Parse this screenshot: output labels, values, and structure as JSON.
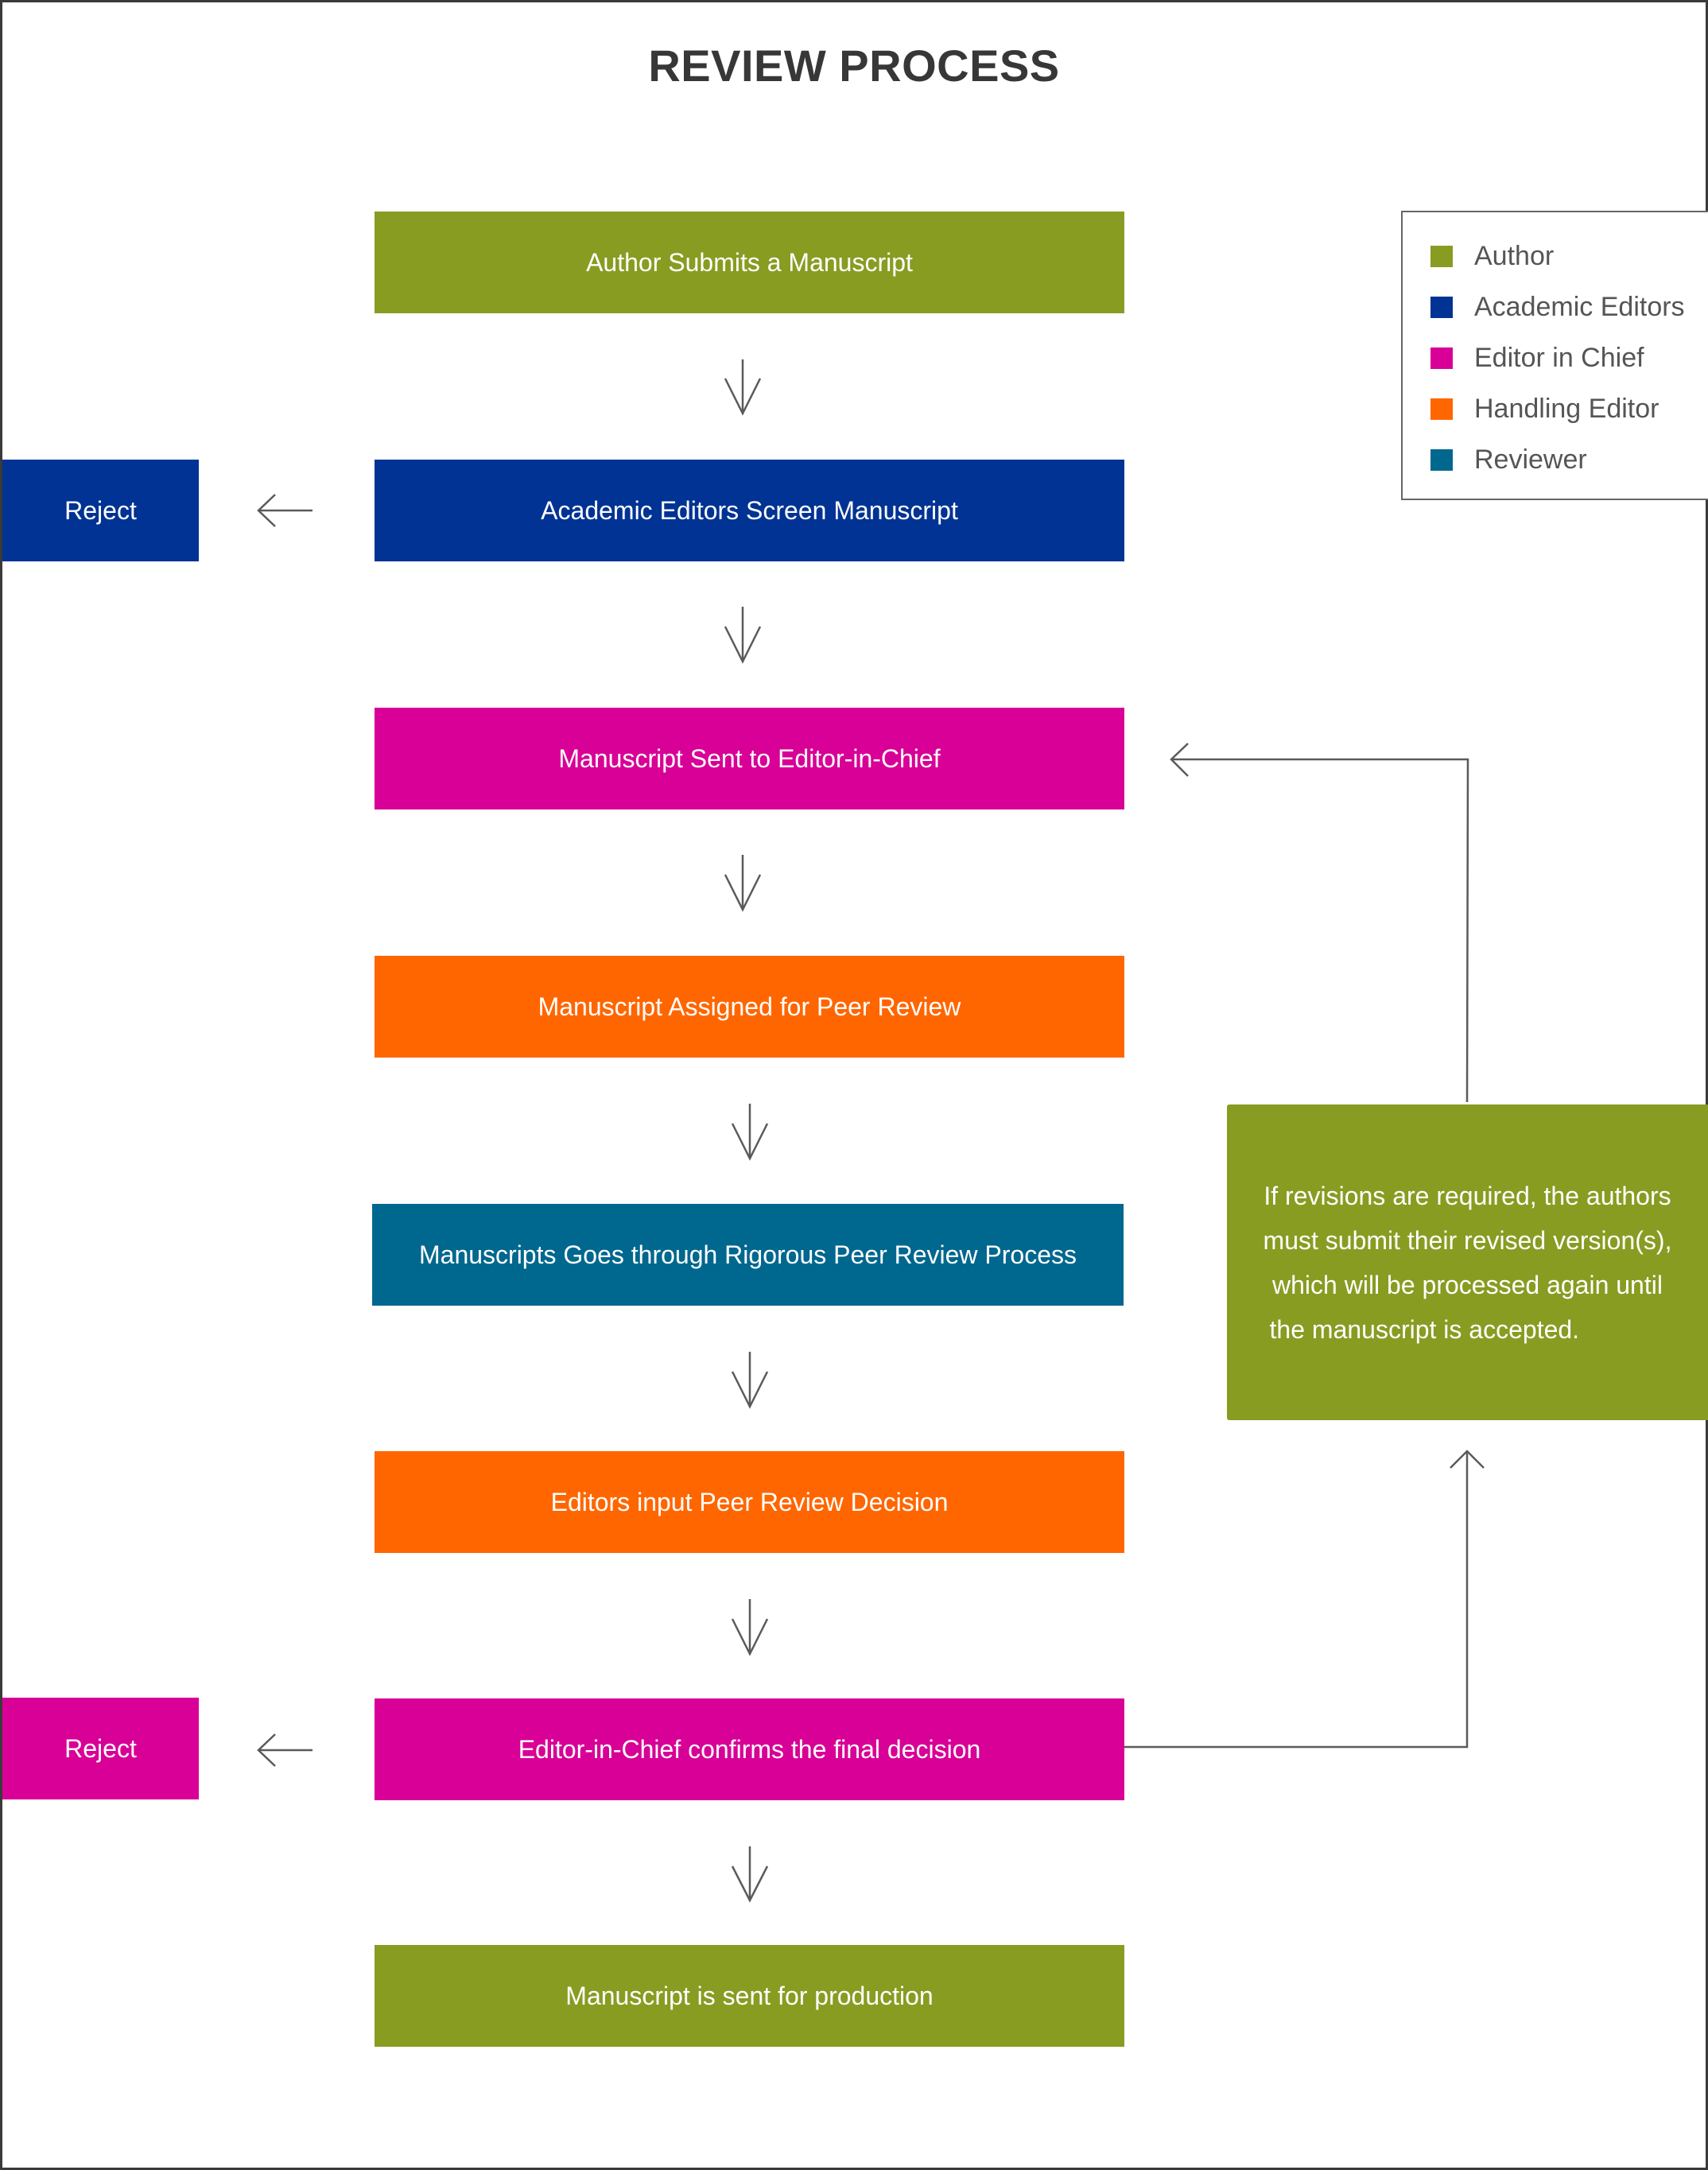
{
  "title": "REVIEW PROCESS",
  "colors": {
    "author": "#889c22",
    "academic_editors": "#003393",
    "editor_in_chief": "#d80096",
    "handling_editor": "#ff6600",
    "reviewer": "#00678e"
  },
  "steps": [
    {
      "label": "Author Submits a Manuscript",
      "role": "Author"
    },
    {
      "label": "Academic Editors Screen Manuscript",
      "role": "Academic Editors"
    },
    {
      "label": "Manuscript Sent to Editor-in-Chief",
      "role": "Editor in Chief"
    },
    {
      "label": "Manuscript Assigned for Peer Review",
      "role": "Handling Editor"
    },
    {
      "label": "Manuscripts Goes through Rigorous Peer Review Process",
      "role": "Reviewer"
    },
    {
      "label": "Editors input Peer Review Decision",
      "role": "Handling Editor"
    },
    {
      "label": "Editor-in-Chief confirms the final decision",
      "role": "Editor in Chief"
    },
    {
      "label": "Manuscript is sent for production",
      "role": "Author"
    }
  ],
  "rejects": [
    {
      "label": "Reject",
      "from_step": 1,
      "role": "Academic Editors"
    },
    {
      "label": "Reject",
      "from_step": 6,
      "role": "Editor in Chief"
    }
  ],
  "revision_note": {
    "lines": [
      "If revisions are required, the authors",
      "must submit their revised version(s),",
      "which will be processed again until",
      "the manuscript  is accepted."
    ],
    "role": "Author"
  },
  "legend": [
    {
      "label": "Author",
      "color": "#889c22"
    },
    {
      "label": "Academic Editors",
      "color": "#003393"
    },
    {
      "label": "Editor in Chief",
      "color": "#d80096"
    },
    {
      "label": "Handling Editor",
      "color": "#ff6600"
    },
    {
      "label": "Reviewer",
      "color": "#00678e"
    }
  ]
}
